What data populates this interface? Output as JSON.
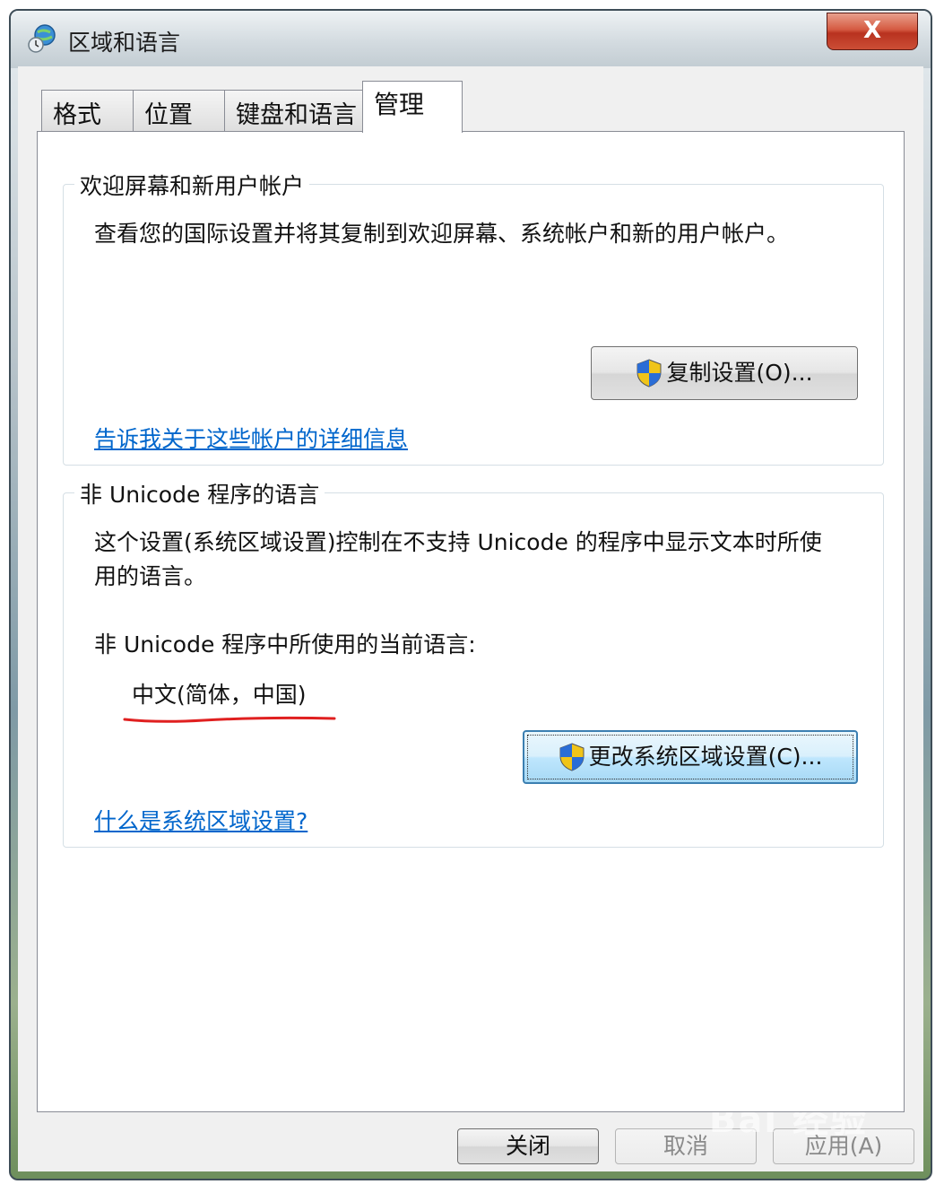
{
  "window": {
    "title": "区域和语言",
    "close_label": "X"
  },
  "tabs": [
    {
      "label": "格式",
      "active": false
    },
    {
      "label": "位置",
      "active": false
    },
    {
      "label": "键盘和语言",
      "active": false
    },
    {
      "label": "管理",
      "active": true
    }
  ],
  "welcome_group": {
    "title": "欢迎屏幕和新用户帐户",
    "description": "查看您的国际设置并将其复制到欢迎屏幕、系统帐户和新的用户帐户。",
    "copy_button_label": "复制设置(O)...",
    "link_text": "告诉我关于这些帐户的详细信息"
  },
  "unicode_group": {
    "title": "非 Unicode 程序的语言",
    "description_line1": "这个设置(系统区域设置)控制在不支持 Unicode 的程序中显示文本时所使",
    "description_line2": "用的语言。",
    "current_label": "非 Unicode 程序中所使用的当前语言:",
    "current_value": "中文(简体，中国)",
    "change_button_label": "更改系统区域设置(C)...",
    "link_text": "什么是系统区域设置?"
  },
  "footer": {
    "close_label": "关闭",
    "cancel_label": "取消",
    "apply_label": "应用(A)"
  },
  "watermark": "Bai 经验",
  "colors": {
    "link": "#0066cc",
    "annotation_underline": "#e02020",
    "close_button": "#c8442d"
  },
  "icons": {
    "title": "globe-clock-icon",
    "uac": "uac-shield-icon"
  }
}
